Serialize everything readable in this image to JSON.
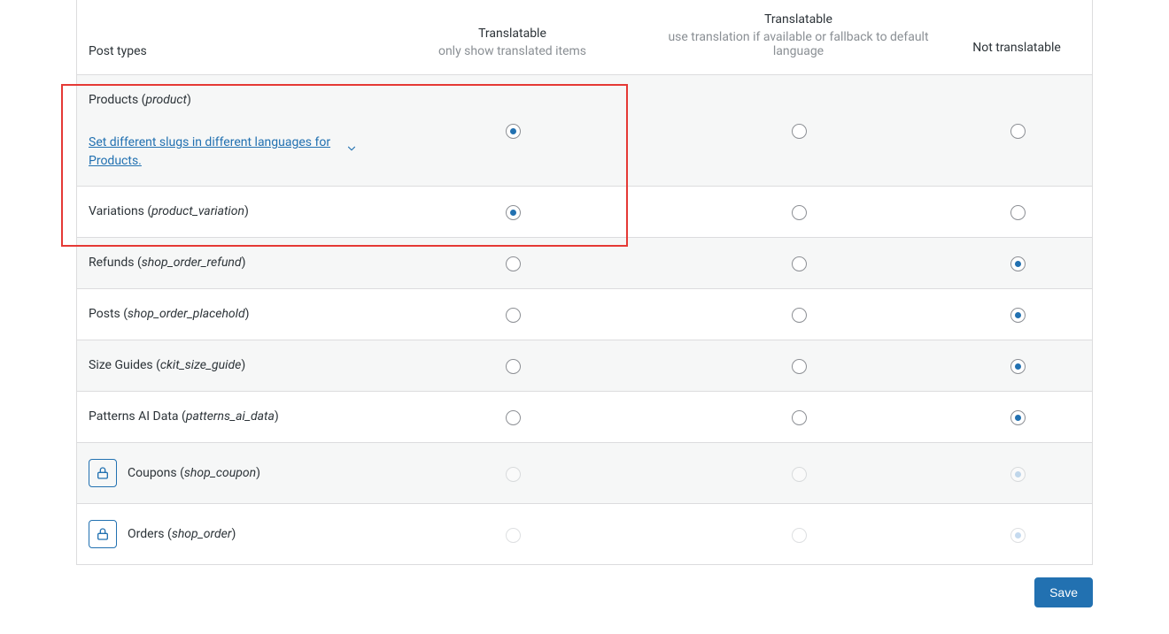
{
  "header": {
    "col_label": "Post types",
    "options": [
      {
        "title": "Translatable",
        "sub": "only show translated items"
      },
      {
        "title": "Translatable",
        "sub": "use translation if available or fallback to default language"
      },
      {
        "title": "Not translatable",
        "sub": ""
      }
    ]
  },
  "slug_link_text": "Set different slugs in different languages for Products.",
  "rows": [
    {
      "id": "products",
      "label": "Products",
      "slug": "product",
      "selected": 0,
      "locked": false,
      "alt": true,
      "has_slug_link": true
    },
    {
      "id": "variations",
      "label": "Variations",
      "slug": "product_variation",
      "selected": 0,
      "locked": false,
      "alt": false
    },
    {
      "id": "refunds",
      "label": "Refunds",
      "slug": "shop_order_refund",
      "selected": 2,
      "locked": false,
      "alt": true
    },
    {
      "id": "posts",
      "label": "Posts",
      "slug": "shop_order_placehold",
      "selected": 2,
      "locked": false,
      "alt": false
    },
    {
      "id": "size_guides",
      "label": "Size Guides",
      "slug": "ckit_size_guide",
      "selected": 2,
      "locked": false,
      "alt": true
    },
    {
      "id": "patterns_ai_data",
      "label": "Patterns AI Data",
      "slug": "patterns_ai_data",
      "selected": 2,
      "locked": false,
      "alt": false
    },
    {
      "id": "coupons",
      "label": "Coupons",
      "slug": "shop_coupon",
      "selected": 2,
      "locked": true,
      "alt": true
    },
    {
      "id": "orders",
      "label": "Orders",
      "slug": "shop_order",
      "selected": 2,
      "locked": true,
      "alt": false
    }
  ],
  "buttons": {
    "save": "Save"
  },
  "highlight": {
    "row_start": 0,
    "row_end": 1,
    "include_first_radio_col": true
  }
}
